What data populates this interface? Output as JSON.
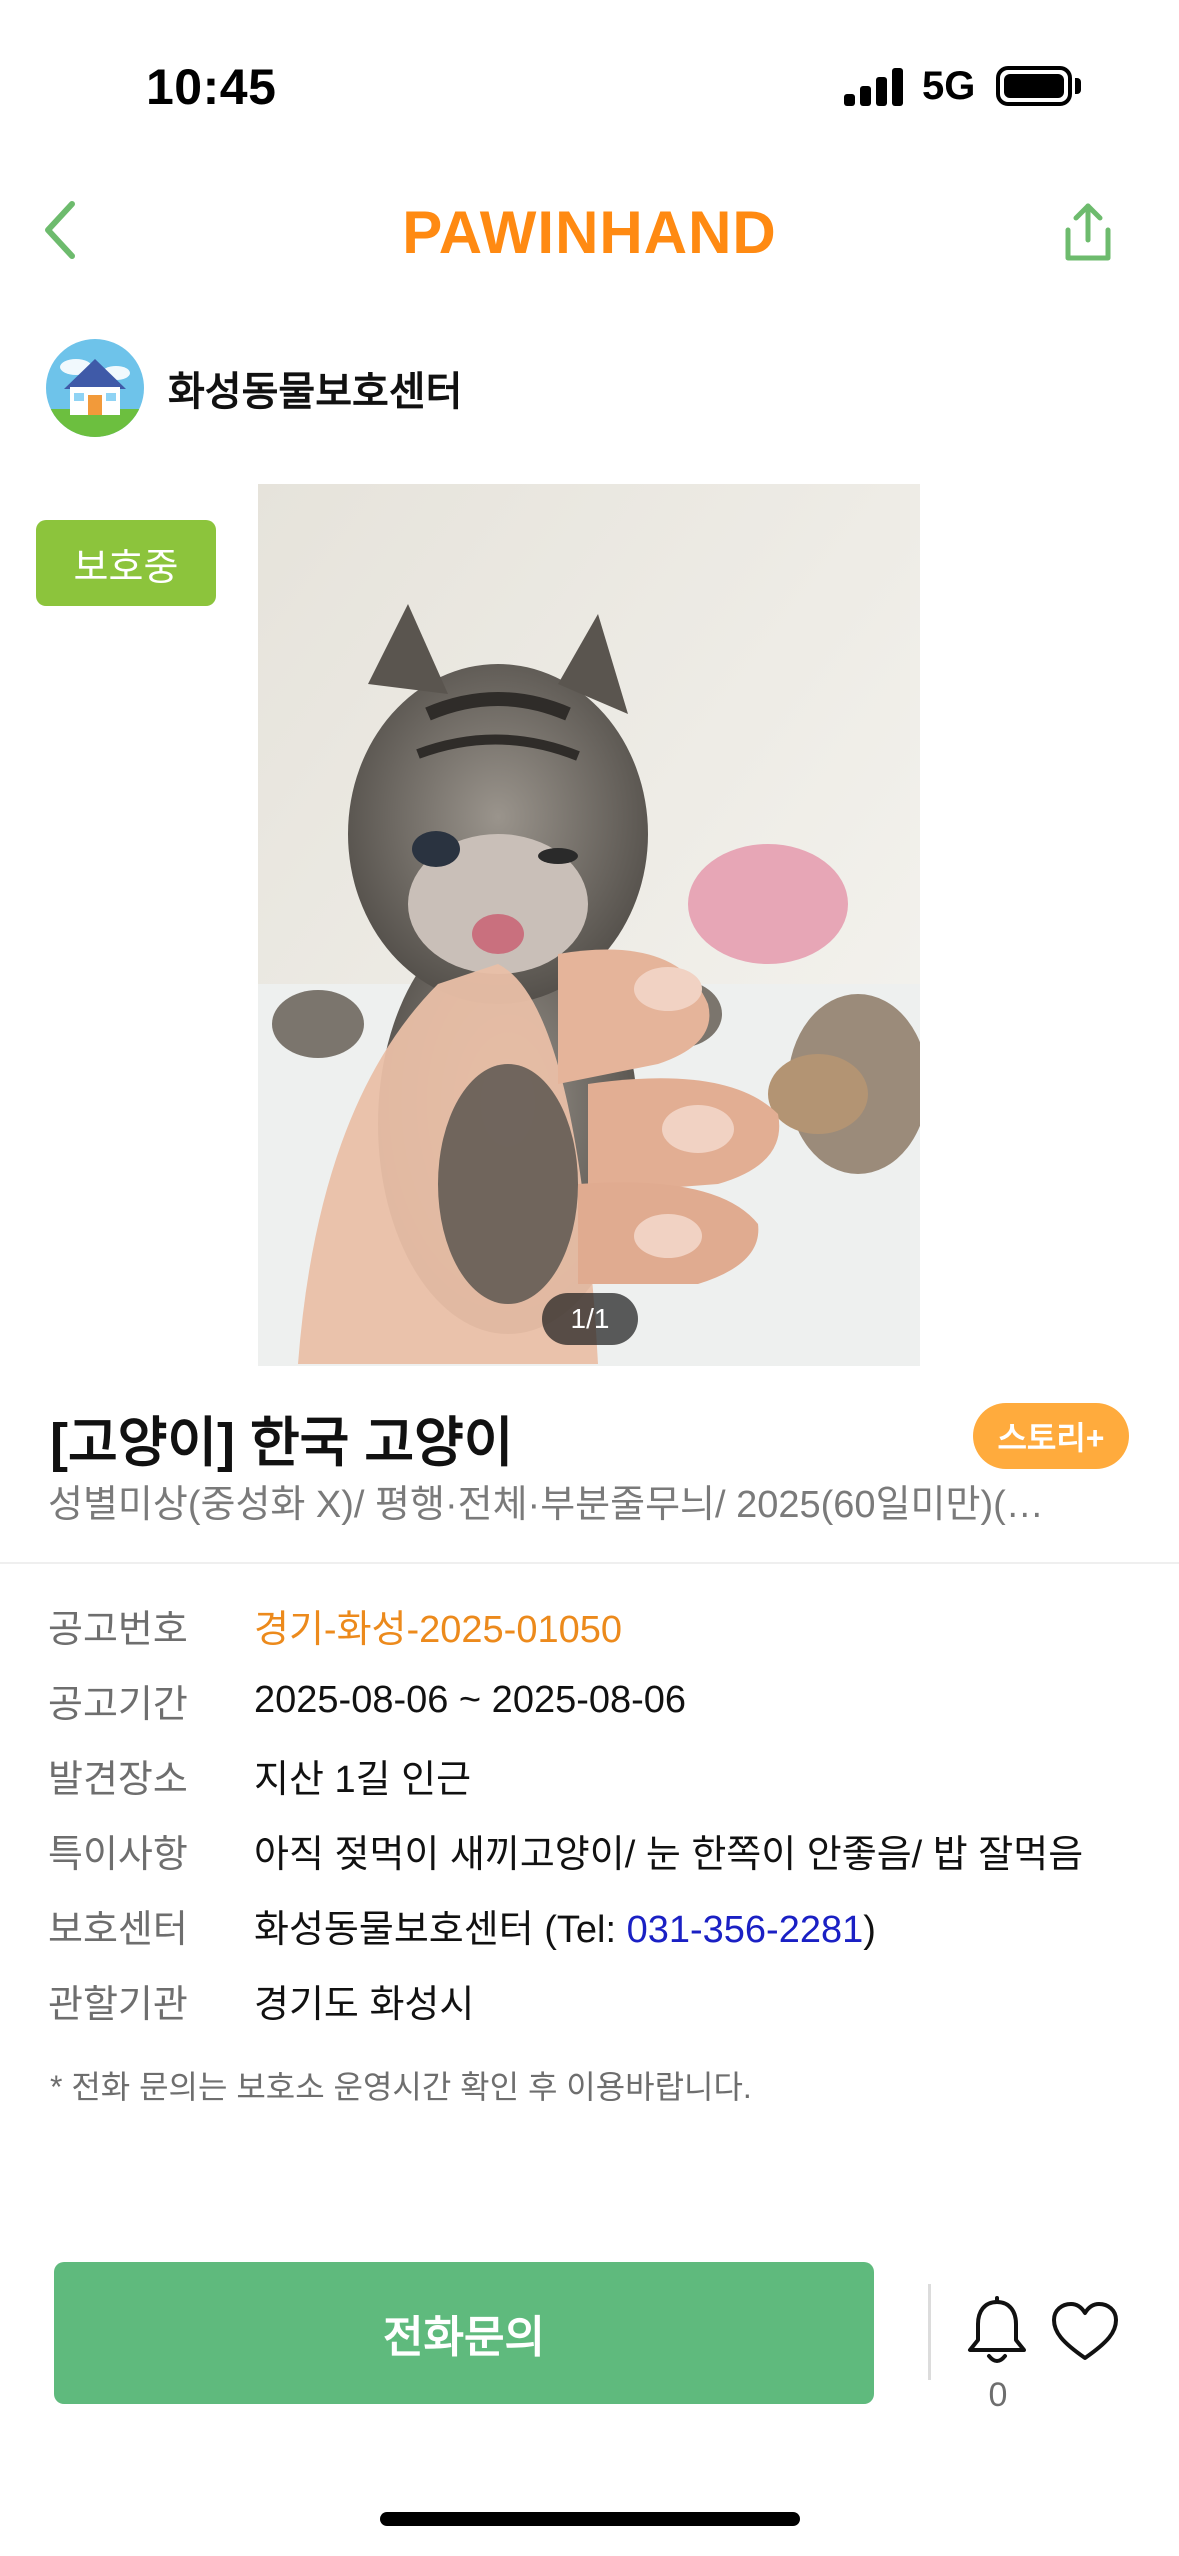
{
  "status_bar": {
    "time": "10:45",
    "network": "5G"
  },
  "header": {
    "brand": "PAWINHAND"
  },
  "shelter": {
    "name": "화성동물보호센터"
  },
  "animal": {
    "status_badge": "보호중",
    "photo_indicator": "1/1",
    "title": "[고양이] 한국 고양이",
    "story_label": "스토리+",
    "subtitle": "성별미상(중성화 X)/ 평행·전체·부분줄무늬/ 2025(60일미만)(…"
  },
  "info": {
    "notice_no_label": "공고번호",
    "notice_no_value": "경기-화성-2025-01050",
    "period_label": "공고기간",
    "period_value": "2025-08-06 ~ 2025-08-06",
    "found_label": "발견장소",
    "found_value": "지산 1길 인근",
    "special_label": "특이사항",
    "special_value": "아직 젖먹이 새끼고양이/ 눈 한쪽이 안좋음/ 밥 잘먹음",
    "center_label": "보호센터",
    "center_value_prefix": "화성동물보호센터 (Tel: ",
    "center_phone": "031-356-2281",
    "center_value_suffix": ")",
    "agency_label": "관할기관",
    "agency_value": "경기도 화성시"
  },
  "notice_text": "* 전화 문의는 보호소 운영시간 확인 후 이용바랍니다.",
  "bottom_bar": {
    "call_label": "전화문의",
    "bell_count": "0"
  },
  "colors": {
    "brand_orange": "#ff8a12",
    "status_green": "#8cc43c",
    "call_green": "#5fba7d",
    "story_orange": "#ffab3d",
    "notice_no_orange": "#ec8a1c",
    "phone_blue": "#1a20c4"
  },
  "icons": [
    "back-chevron-icon",
    "share-icon",
    "house-icon",
    "bell-icon",
    "heart-icon"
  ]
}
